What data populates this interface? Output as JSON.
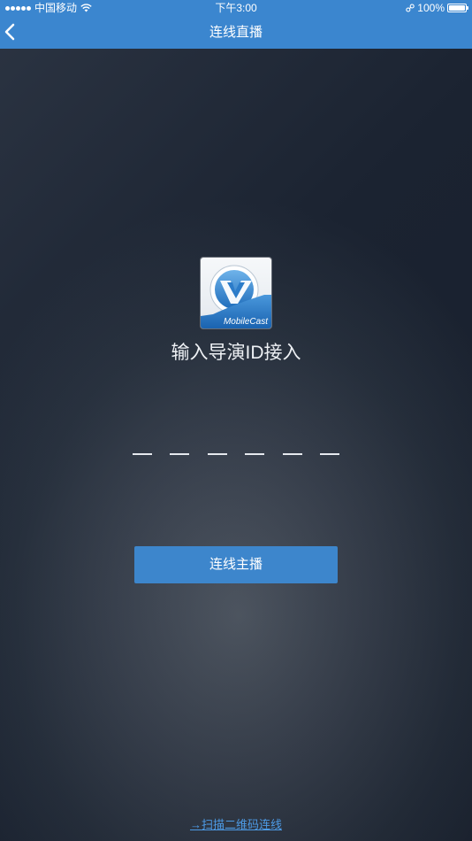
{
  "status_bar": {
    "carrier": "中国移动",
    "time": "下午3:00",
    "battery": "100%",
    "icons": [
      "signal-dots-icon",
      "wifi-icon",
      "link-icon",
      "battery-icon"
    ]
  },
  "nav": {
    "title": "连线直播",
    "back_icon": "chevron-left-icon"
  },
  "logo": {
    "text": "MobileCast"
  },
  "heading": "输入导演ID接入",
  "id_input": {
    "slots": 6
  },
  "connect_button": "连线主播",
  "scan_link": "→扫描二维码连线",
  "colors": {
    "nav_bar": "#3b86cf",
    "button": "#3d86cc",
    "link": "#4d9be6",
    "background": "#1e2531"
  }
}
